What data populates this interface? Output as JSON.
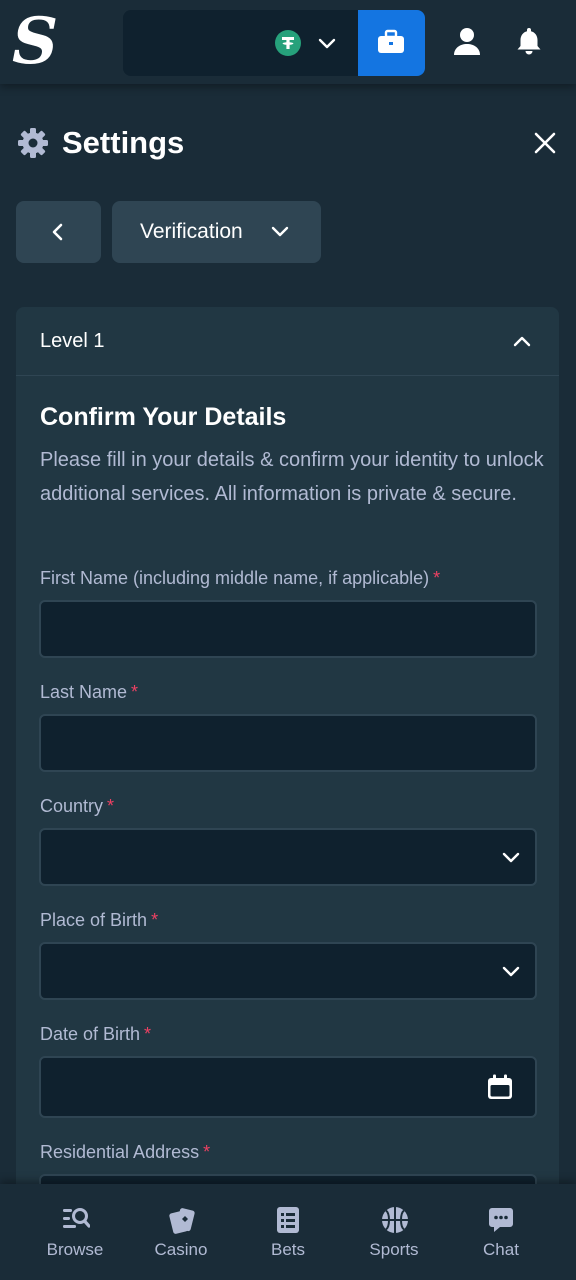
{
  "header": {
    "logo_text": "S",
    "wallet": {
      "currency_icon": "tether-icon",
      "dropdown_icon": "chevron-down-icon",
      "button_icon": "wallet-icon"
    },
    "user_icon": "user-icon",
    "notification_icon": "bell-icon"
  },
  "settings": {
    "title": "Settings",
    "icon": "gear-icon",
    "close_icon": "close-icon",
    "back_icon": "chevron-left-icon",
    "section_selector": "Verification"
  },
  "card": {
    "level_label": "Level 1",
    "title": "Confirm Your Details",
    "description": "Please fill in your details & confirm your identity to unlock additional services. All information is private & secure.",
    "required_mark": "*",
    "fields": [
      {
        "label": "First Name (including middle name, if applicable)",
        "value": "",
        "type": "text"
      },
      {
        "label": "Last Name",
        "value": "",
        "type": "text"
      },
      {
        "label": "Country",
        "value": "",
        "type": "select"
      },
      {
        "label": "Place of Birth",
        "value": "",
        "type": "select"
      },
      {
        "label": "Date of Birth",
        "value": "",
        "type": "date"
      },
      {
        "label": "Residential Address",
        "value": "",
        "type": "text"
      }
    ]
  },
  "bottom_nav": [
    {
      "label": "Browse",
      "icon": "browse-icon"
    },
    {
      "label": "Casino",
      "icon": "cards-icon"
    },
    {
      "label": "Bets",
      "icon": "bets-icon"
    },
    {
      "label": "Sports",
      "icon": "basketball-icon"
    },
    {
      "label": "Chat",
      "icon": "chat-icon"
    }
  ],
  "colors": {
    "background": "#1a2c38",
    "card": "#213743",
    "input": "#0f212e",
    "accent": "#1475e1",
    "muted_text": "#b1bad3",
    "required": "#ed4163",
    "tether": "#26a17b"
  }
}
